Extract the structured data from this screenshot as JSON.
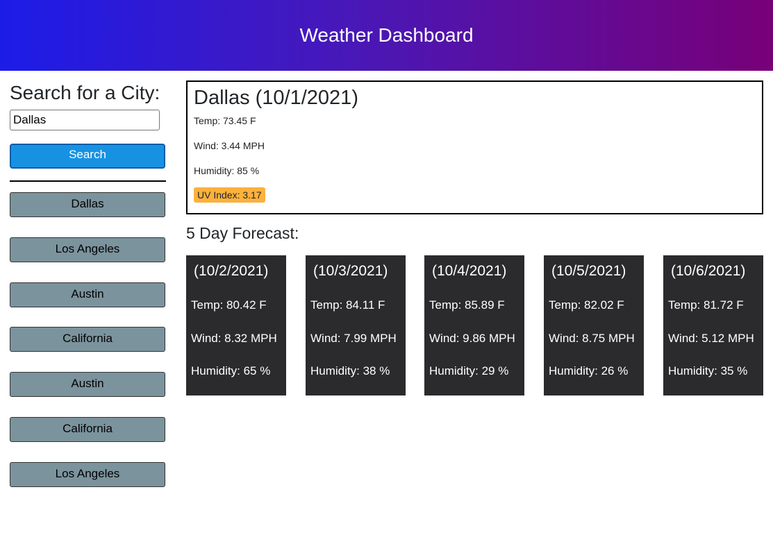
{
  "header": {
    "title": "Weather Dashboard"
  },
  "search": {
    "title": "Search for a City:",
    "input_value": "Dallas",
    "button_label": "Search"
  },
  "history": [
    "Dallas",
    "Los Angeles",
    "Austin",
    "California",
    "Austin",
    "California",
    "Los Angeles"
  ],
  "current": {
    "title": "Dallas (10/1/2021)",
    "temp": "Temp: 73.45 F",
    "wind": "Wind: 3.44 MPH",
    "humidity": "Humidity: 85 %",
    "uv": "UV Index: 3.17",
    "uv_color": "#fbb13c"
  },
  "forecast": {
    "title": "5 Day Forecast:",
    "days": [
      {
        "date": "(10/2/2021)",
        "temp": "Temp: 80.42 F",
        "wind": "Wind: 8.32 MPH",
        "humidity": "Humidity: 65 %"
      },
      {
        "date": "(10/3/2021)",
        "temp": "Temp: 84.11 F",
        "wind": "Wind: 7.99 MPH",
        "humidity": "Humidity: 38 %"
      },
      {
        "date": "(10/4/2021)",
        "temp": "Temp: 85.89 F",
        "wind": "Wind: 9.86 MPH",
        "humidity": "Humidity: 29 %"
      },
      {
        "date": "(10/5/2021)",
        "temp": "Temp: 82.02 F",
        "wind": "Wind: 8.75 MPH",
        "humidity": "Humidity: 26 %"
      },
      {
        "date": "(10/6/2021)",
        "temp": "Temp: 81.72 F",
        "wind": "Wind: 5.12 MPH",
        "humidity": "Humidity: 35 %"
      }
    ]
  },
  "colors": {
    "header_gradient_start": "#1c1ce8",
    "header_gradient_end": "#780078",
    "search_button": "#1792e3",
    "history_button": "#7b939d",
    "forecast_card": "#2b2b2d"
  }
}
